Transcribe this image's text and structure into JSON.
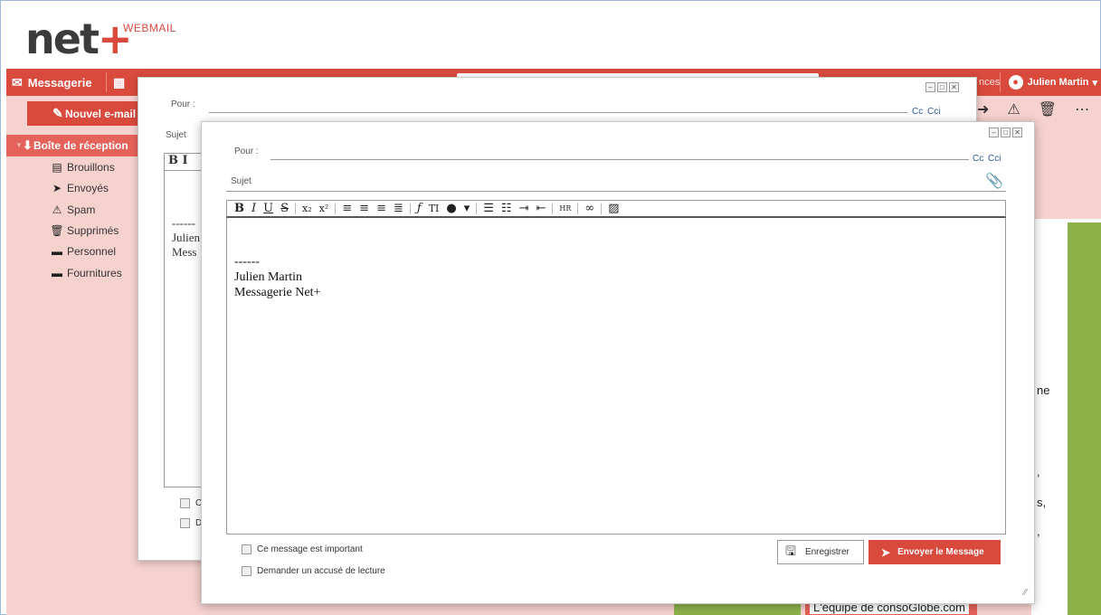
{
  "app": {
    "logo_text": "net",
    "logo_plus": "+",
    "logo_sup": "WEBMAIL"
  },
  "navbar": {
    "mail_label": "Messagerie",
    "prefs_fragment": "nces",
    "user_name": "Julien Martin",
    "user_caret": "▾"
  },
  "sidebar": {
    "new_email_label": "Nouvel e-mail",
    "inbox_label": "Boîte de réception",
    "folders": [
      {
        "label": "Brouillons",
        "icon": "draft-icon"
      },
      {
        "label": "Envoyés",
        "icon": "sent-icon"
      },
      {
        "label": "Spam",
        "icon": "spam-icon"
      },
      {
        "label": "Supprimés",
        "icon": "trash-icon"
      },
      {
        "label": "Personnel",
        "icon": "folder-icon"
      },
      {
        "label": "Fournitures",
        "icon": "folder-icon"
      }
    ]
  },
  "background_content": {
    "peek_ne": "ne",
    "peek_comma1": ",",
    "peek_s": "s,",
    "peek_comma2": ",",
    "footer_fragment": "L'équipe de consoGlobe.com"
  },
  "compose_back": {
    "to_label": "Pour :",
    "cc_label": "Cc",
    "bcc_label": "Cci",
    "subject_label": "Sujet",
    "toolbar_fragment": "B I",
    "sig_dashes": "------",
    "sig_name_fragment": "Julien",
    "sig_app_fragment": "Mess",
    "check1_fragment": "C",
    "check2_fragment": "D"
  },
  "compose_front": {
    "to_label": "Pour :",
    "cc_label": "Cc",
    "bcc_label": "Cci",
    "subject_label": "Sujet",
    "signature_dashes": "------",
    "signature_name": "Julien Martin",
    "signature_app": "Messagerie Net+",
    "important_label": "Ce message est important",
    "receipt_label": "Demander un accusé de lecture",
    "save_label": "Enregistrer",
    "send_label": "Envoyer le Message"
  },
  "colors": {
    "accent_red": "#d94a3d",
    "sidebar_pink": "#f6d2cf",
    "accent_green": "#8db24a",
    "link_blue": "#2e5a99"
  }
}
